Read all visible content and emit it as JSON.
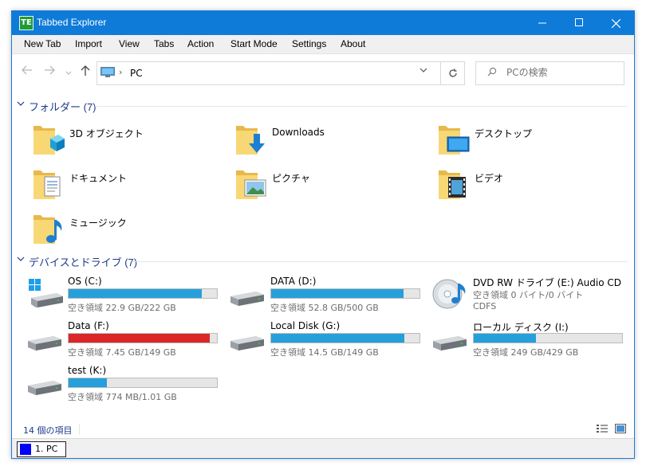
{
  "window": {
    "title": "Tabbed Explorer",
    "app_icon_text": "TE"
  },
  "menu": [
    "New Tab",
    "Import",
    "View",
    "Tabs",
    "Action",
    "Start Mode",
    "Settings",
    "About"
  ],
  "address": {
    "path": "PC",
    "separator": "›"
  },
  "search": {
    "placeholder": "PCの検索"
  },
  "folders_group": {
    "title": "フォルダー (7)",
    "items": [
      {
        "label": "3D オブジェクト",
        "icon": "3d-objects-folder-icon"
      },
      {
        "label": "Downloads",
        "icon": "downloads-folder-icon"
      },
      {
        "label": "デスクトップ",
        "icon": "desktop-folder-icon"
      },
      {
        "label": "ドキュメント",
        "icon": "documents-folder-icon"
      },
      {
        "label": "ピクチャ",
        "icon": "pictures-folder-icon"
      },
      {
        "label": "ビデオ",
        "icon": "videos-folder-icon"
      },
      {
        "label": "ミュージック",
        "icon": "music-folder-icon"
      }
    ]
  },
  "drives_group": {
    "title": "デバイスとドライブ (7)",
    "items": [
      {
        "name": "OS (C:)",
        "free": "空き領域 22.9 GB/222 GB",
        "used_fraction": 0.9,
        "alert": false,
        "icon": "windows-drive-icon"
      },
      {
        "name": "DATA (D:)",
        "free": "空き領域 52.8 GB/500 GB",
        "used_fraction": 0.89,
        "alert": false,
        "icon": "hard-drive-icon"
      },
      {
        "name": "DVD RW ドライブ (E:) Audio CD",
        "free": "空き領域 0 バイト/0 バイト",
        "fs": "CDFS",
        "used_fraction": null,
        "alert": false,
        "icon": "audio-cd-icon"
      },
      {
        "name": "Data (F:)",
        "free": "空き領域 7.45 GB/149 GB",
        "used_fraction": 0.95,
        "alert": true,
        "icon": "hard-drive-icon"
      },
      {
        "name": "Local Disk (G:)",
        "free": "空き領域 14.5 GB/149 GB",
        "used_fraction": 0.9,
        "alert": false,
        "icon": "hard-drive-icon"
      },
      {
        "name": "ローカル ディスク (I:)",
        "free": "空き領域 249 GB/429 GB",
        "used_fraction": 0.42,
        "alert": false,
        "icon": "hard-drive-icon"
      },
      {
        "name": "test (K:)",
        "free": "空き領域 774 MB/1.01 GB",
        "used_fraction": 0.26,
        "alert": false,
        "icon": "hard-drive-icon"
      }
    ]
  },
  "status": {
    "item_count": "14 個の項目"
  },
  "tabs": [
    {
      "label": "1. PC",
      "color": "#0000ff"
    }
  ],
  "colors": {
    "accent": "#0f7bd8",
    "bar_normal": "#26a0da",
    "bar_alert": "#da2626",
    "group_text": "#1e3a8a"
  }
}
